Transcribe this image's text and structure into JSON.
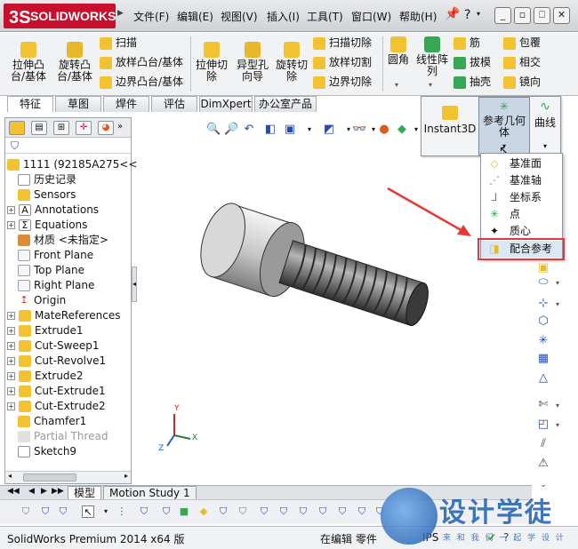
{
  "app": {
    "logo_text": "SOLIDWORKS",
    "logo_mark": "3S"
  },
  "menu": {
    "items": [
      "文件(F)",
      "编辑(E)",
      "视图(V)",
      "插入(I)",
      "工具(T)",
      "窗口(W)",
      "帮助(H)"
    ]
  },
  "window_controls": [
    "_",
    "▫",
    "⎕",
    "✕"
  ],
  "ribbon": {
    "big_buttons": [
      "拉伸凸台/基体",
      "旋转凸台/基体",
      "拉伸切除",
      "异型孔向导",
      "旋转切除",
      "圆角",
      "线性阵列"
    ],
    "boss_small": [
      "扫描",
      "放样凸台/基体",
      "边界凸台/基体"
    ],
    "cut_small": [
      "扫描切除",
      "放样切割",
      "边界切除"
    ],
    "right_small": [
      "筋",
      "拔模",
      "抽壳",
      "包覆",
      "相交",
      "镜向"
    ]
  },
  "cm_tabs": [
    "特征",
    "草图",
    "焊件",
    "评估",
    "DimXpert",
    "办公室产品"
  ],
  "flyout": {
    "instant3d": "Instant3D",
    "ref_geometry": "参考几何体",
    "curves": "曲线"
  },
  "ref_geometry_menu": [
    {
      "label": "基准面",
      "icon": "plane-icon"
    },
    {
      "label": "基准轴",
      "icon": "axis-icon"
    },
    {
      "label": "坐标系",
      "icon": "coordinate-system-icon"
    },
    {
      "label": "点",
      "icon": "point-icon"
    },
    {
      "label": "质心",
      "icon": "center-of-mass-icon"
    },
    {
      "label": "配合参考",
      "icon": "mate-reference-icon"
    }
  ],
  "feature_tree": {
    "root": "1111  (92185A275<<",
    "items": [
      "历史记录",
      "Sensors",
      "Annotations",
      "Equations",
      "材质 <未指定>",
      "Front Plane",
      "Top Plane",
      "Right Plane",
      "Origin",
      "MateReferences",
      "Extrude1",
      "Cut-Sweep1",
      "Cut-Revolve1",
      "Extrude2",
      "Cut-Extrude1",
      "Cut-Extrude2",
      "Chamfer1",
      "Partial Thread",
      "Sketch9"
    ]
  },
  "triad": {
    "x": "X",
    "y": "Y",
    "z": "Z"
  },
  "bottom_tabs": [
    "模型",
    "Motion Study 1"
  ],
  "status": {
    "product": "SolidWorks Premium 2014 x64 版",
    "mode": "在编辑 零件",
    "units": "IPS"
  },
  "watermark": {
    "title": "设计学徒",
    "subtitle": "来 和 我 们 一 起 学 设 计"
  },
  "colors": {
    "accent_red": "#e53935",
    "logo_red": "#c8102e",
    "icon_yellow": "#f2c230",
    "icon_green": "#34a853",
    "icon_blue": "#2a48b8"
  }
}
